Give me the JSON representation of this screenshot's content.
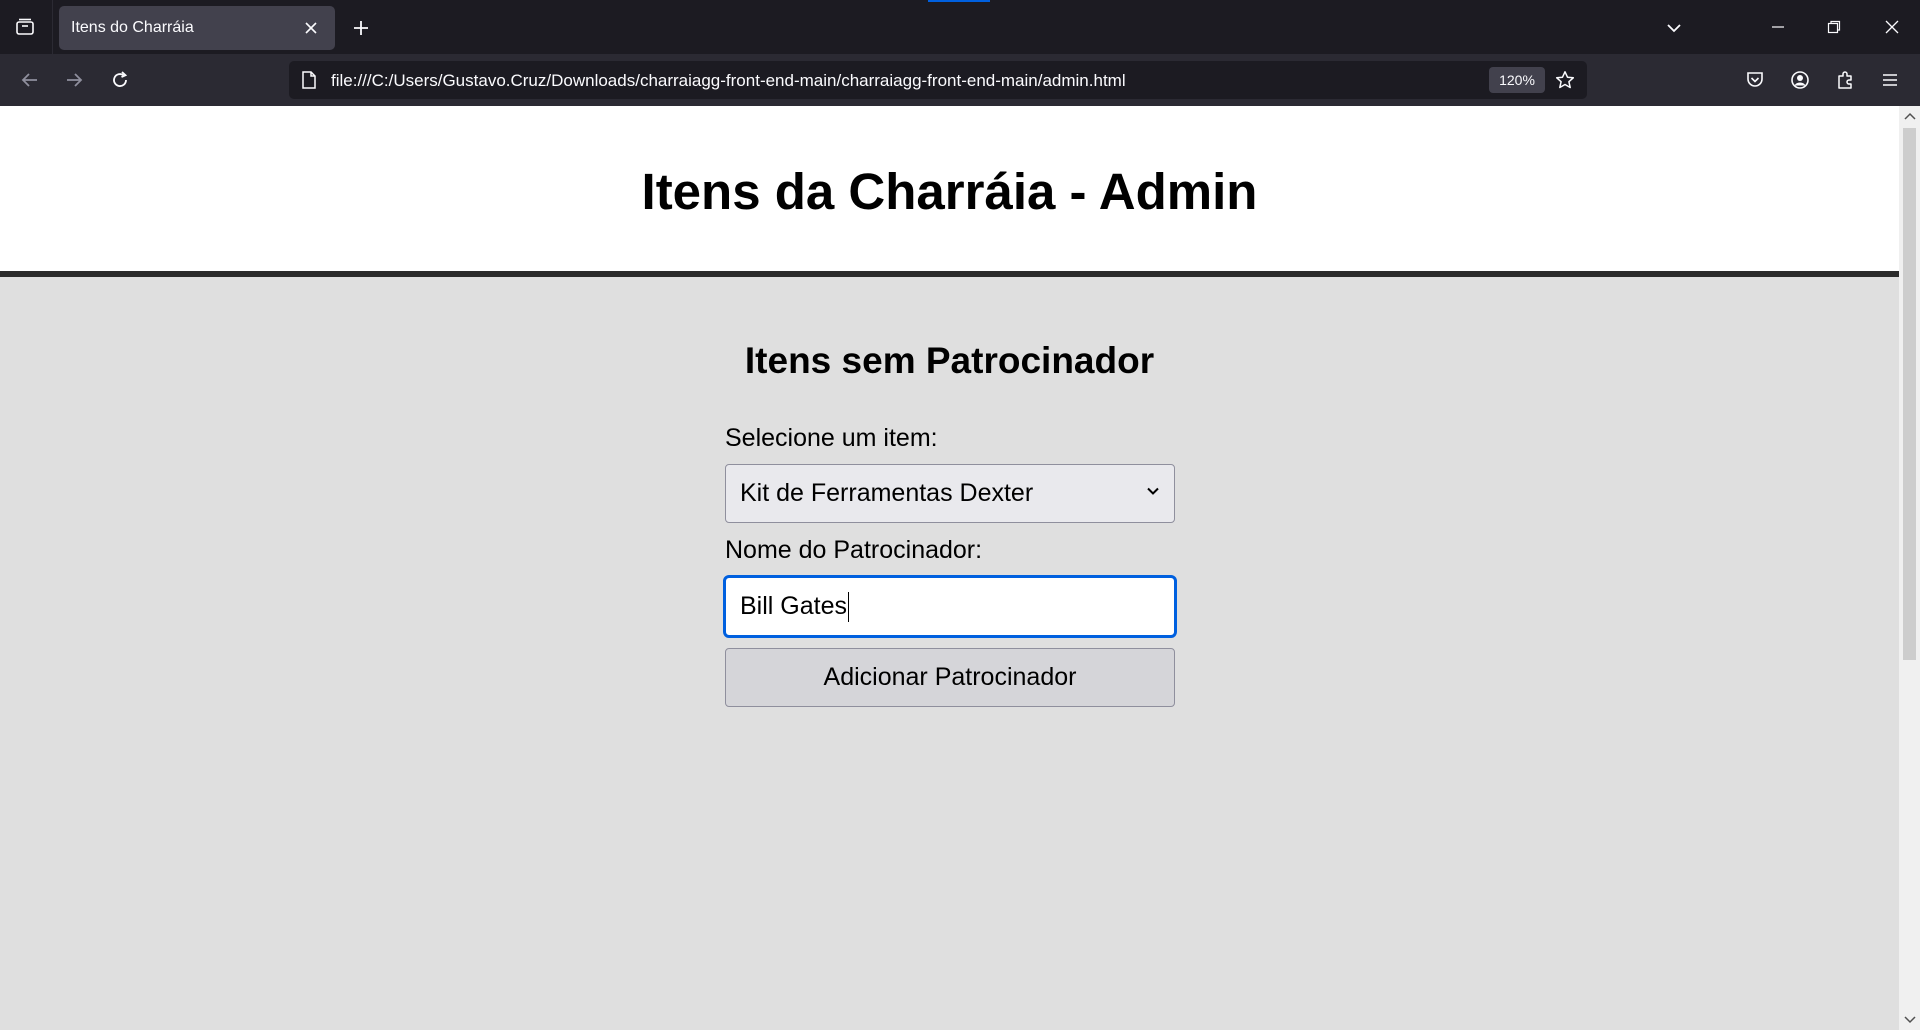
{
  "browser": {
    "tab_title": "Itens do Charráia",
    "url": "file:///C:/Users/Gustavo.Cruz/Downloads/charraiagg-front-end-main/charraiagg-front-end-main/admin.html",
    "zoom": "120%",
    "icons": [
      "tab-list-icon",
      "close-icon",
      "plus-icon",
      "chevron-down-icon",
      "minimize-icon",
      "restore-icon",
      "close-window-icon",
      "back-arrow-icon",
      "forward-arrow-icon",
      "reload-icon",
      "page-icon",
      "star-icon",
      "pocket-icon",
      "account-icon",
      "extensions-icon",
      "menu-icon"
    ],
    "accent_color": "#0060df"
  },
  "page": {
    "title": "Itens da Charráia - Admin",
    "section_title": "Itens sem Patrocinador",
    "select_label": "Selecione um item:",
    "select_value": "Kit de Ferramentas Dexter",
    "sponsor_label": "Nome do Patrocinador:",
    "sponsor_value": "Bill Gates",
    "add_button_label": "Adicionar Patrocinador"
  }
}
